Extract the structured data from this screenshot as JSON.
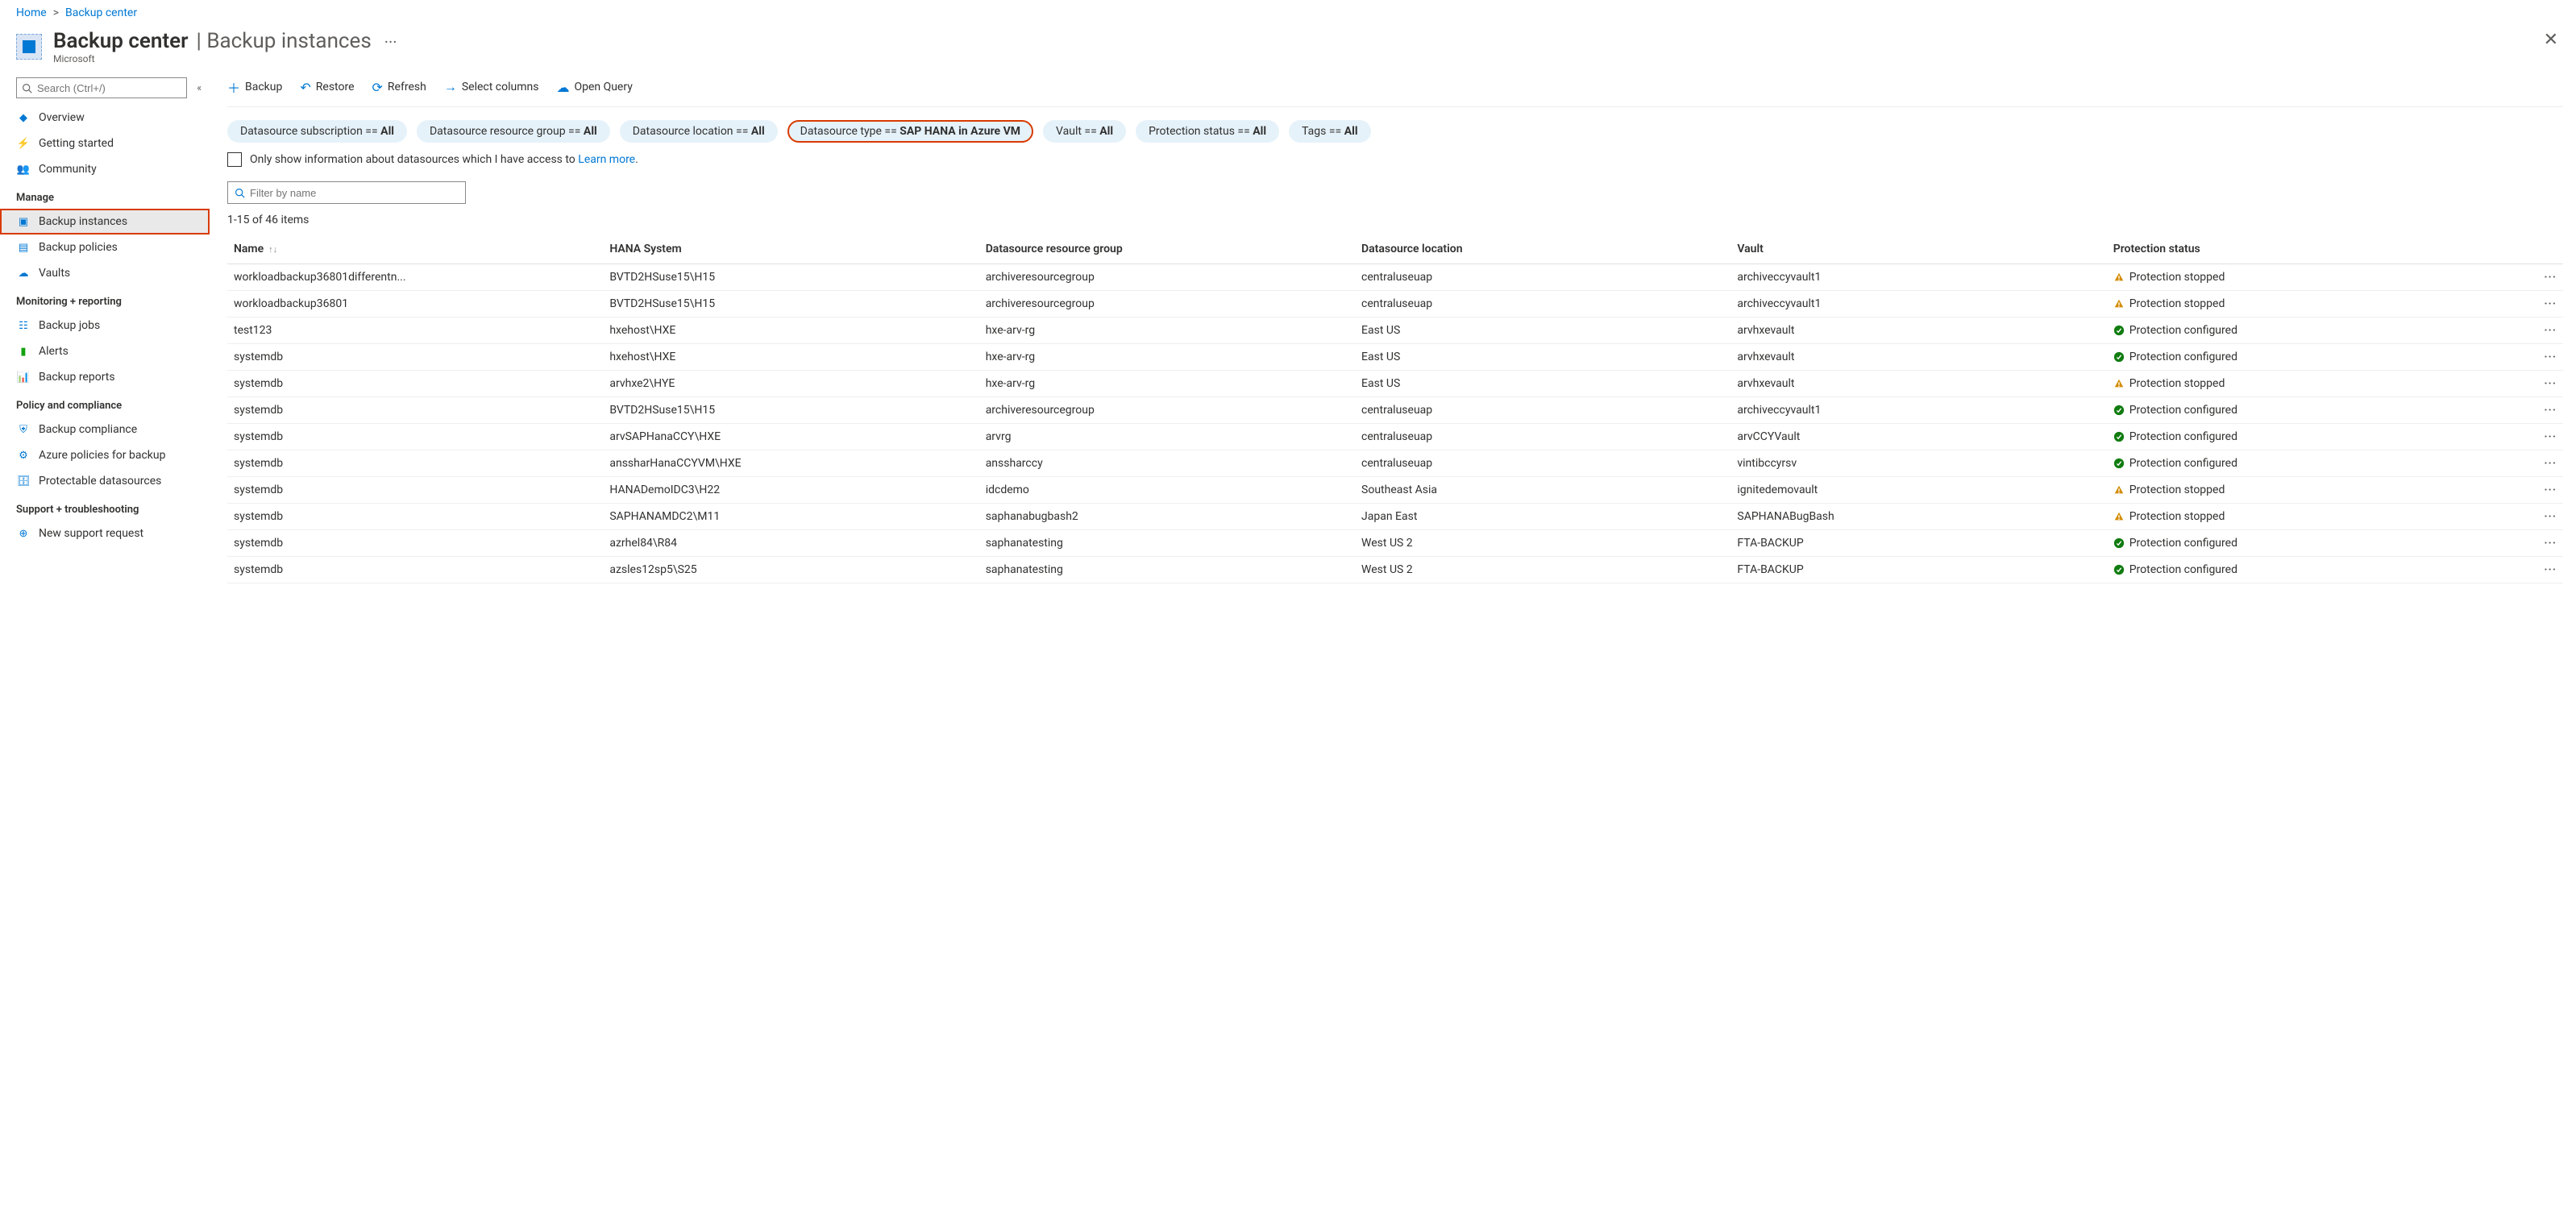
{
  "breadcrumb": {
    "home": "Home",
    "current": "Backup center"
  },
  "header": {
    "title": "Backup center",
    "subtitle": "Backup instances",
    "org": "Microsoft"
  },
  "sidebar": {
    "search_placeholder": "Search (Ctrl+/)",
    "items_top": [
      {
        "label": "Overview"
      },
      {
        "label": "Getting started"
      },
      {
        "label": "Community"
      }
    ],
    "manage_label": "Manage",
    "items_manage": [
      {
        "label": "Backup instances"
      },
      {
        "label": "Backup policies"
      },
      {
        "label": "Vaults"
      }
    ],
    "monitor_label": "Monitoring + reporting",
    "items_monitor": [
      {
        "label": "Backup jobs"
      },
      {
        "label": "Alerts"
      },
      {
        "label": "Backup reports"
      }
    ],
    "policy_label": "Policy and compliance",
    "items_policy": [
      {
        "label": "Backup compliance"
      },
      {
        "label": "Azure policies for backup"
      },
      {
        "label": "Protectable datasources"
      }
    ],
    "support_label": "Support + troubleshooting",
    "items_support": [
      {
        "label": "New support request"
      }
    ]
  },
  "toolbar": {
    "backup": "Backup",
    "restore": "Restore",
    "refresh": "Refresh",
    "select_columns": "Select columns",
    "open_query": "Open Query"
  },
  "filters": {
    "f1_label": "Datasource subscription == ",
    "f1_val": "All",
    "f2_label": "Datasource resource group == ",
    "f2_val": "All",
    "f3_label": "Datasource location == ",
    "f3_val": "All",
    "f4_label": "Datasource type == ",
    "f4_val": "SAP HANA in Azure VM",
    "f5_label": "Vault == ",
    "f5_val": "All",
    "f6_label": "Protection status == ",
    "f6_val": "All",
    "f7_label": "Tags == ",
    "f7_val": "All"
  },
  "info": {
    "checkbox_label": "Only show information about datasources which I have access to",
    "learn_more": "Learn more",
    "filter_placeholder": "Filter by name",
    "items_count": "1-15 of 46 items"
  },
  "table": {
    "headers": {
      "name": "Name",
      "hana": "HANA System",
      "rg": "Datasource resource group",
      "loc": "Datasource location",
      "vault": "Vault",
      "prot": "Protection status"
    },
    "statuses": {
      "stopped": "Protection stopped",
      "configured": "Protection configured"
    },
    "rows": [
      {
        "name": "workloadbackup36801differentn...",
        "hana": "BVTD2HSuse15\\H15",
        "rg": "archiveresourcegroup",
        "loc": "centraluseuap",
        "vault": "archiveccyvault1",
        "status": "stopped"
      },
      {
        "name": "workloadbackup36801",
        "hana": "BVTD2HSuse15\\H15",
        "rg": "archiveresourcegroup",
        "loc": "centraluseuap",
        "vault": "archiveccyvault1",
        "status": "stopped"
      },
      {
        "name": "test123",
        "hana": "hxehost\\HXE",
        "rg": "hxe-arv-rg",
        "loc": "East US",
        "vault": "arvhxevault",
        "status": "configured"
      },
      {
        "name": "systemdb",
        "hana": "hxehost\\HXE",
        "rg": "hxe-arv-rg",
        "loc": "East US",
        "vault": "arvhxevault",
        "status": "configured"
      },
      {
        "name": "systemdb",
        "hana": "arvhxe2\\HYE",
        "rg": "hxe-arv-rg",
        "loc": "East US",
        "vault": "arvhxevault",
        "status": "stopped"
      },
      {
        "name": "systemdb",
        "hana": "BVTD2HSuse15\\H15",
        "rg": "archiveresourcegroup",
        "loc": "centraluseuap",
        "vault": "archiveccyvault1",
        "status": "configured"
      },
      {
        "name": "systemdb",
        "hana": "arvSAPHanaCCY\\HXE",
        "rg": "arvrg",
        "loc": "centraluseuap",
        "vault": "arvCCYVault",
        "status": "configured"
      },
      {
        "name": "systemdb",
        "hana": "anssharHanaCCYVM\\HXE",
        "rg": "anssharccy",
        "loc": "centraluseuap",
        "vault": "vintibccyrsv",
        "status": "configured"
      },
      {
        "name": "systemdb",
        "hana": "HANADemoIDC3\\H22",
        "rg": "idcdemo",
        "loc": "Southeast Asia",
        "vault": "ignitedemovault",
        "status": "stopped"
      },
      {
        "name": "systemdb",
        "hana": "SAPHANAMDC2\\M11",
        "rg": "saphanabugbash2",
        "loc": "Japan East",
        "vault": "SAPHANABugBash",
        "status": "stopped"
      },
      {
        "name": "systemdb",
        "hana": "azrhel84\\R84",
        "rg": "saphanatesting",
        "loc": "West US 2",
        "vault": "FTA-BACKUP",
        "status": "configured"
      },
      {
        "name": "systemdb",
        "hana": "azsles12sp5\\S25",
        "rg": "saphanatesting",
        "loc": "West US 2",
        "vault": "FTA-BACKUP",
        "status": "configured"
      }
    ]
  }
}
